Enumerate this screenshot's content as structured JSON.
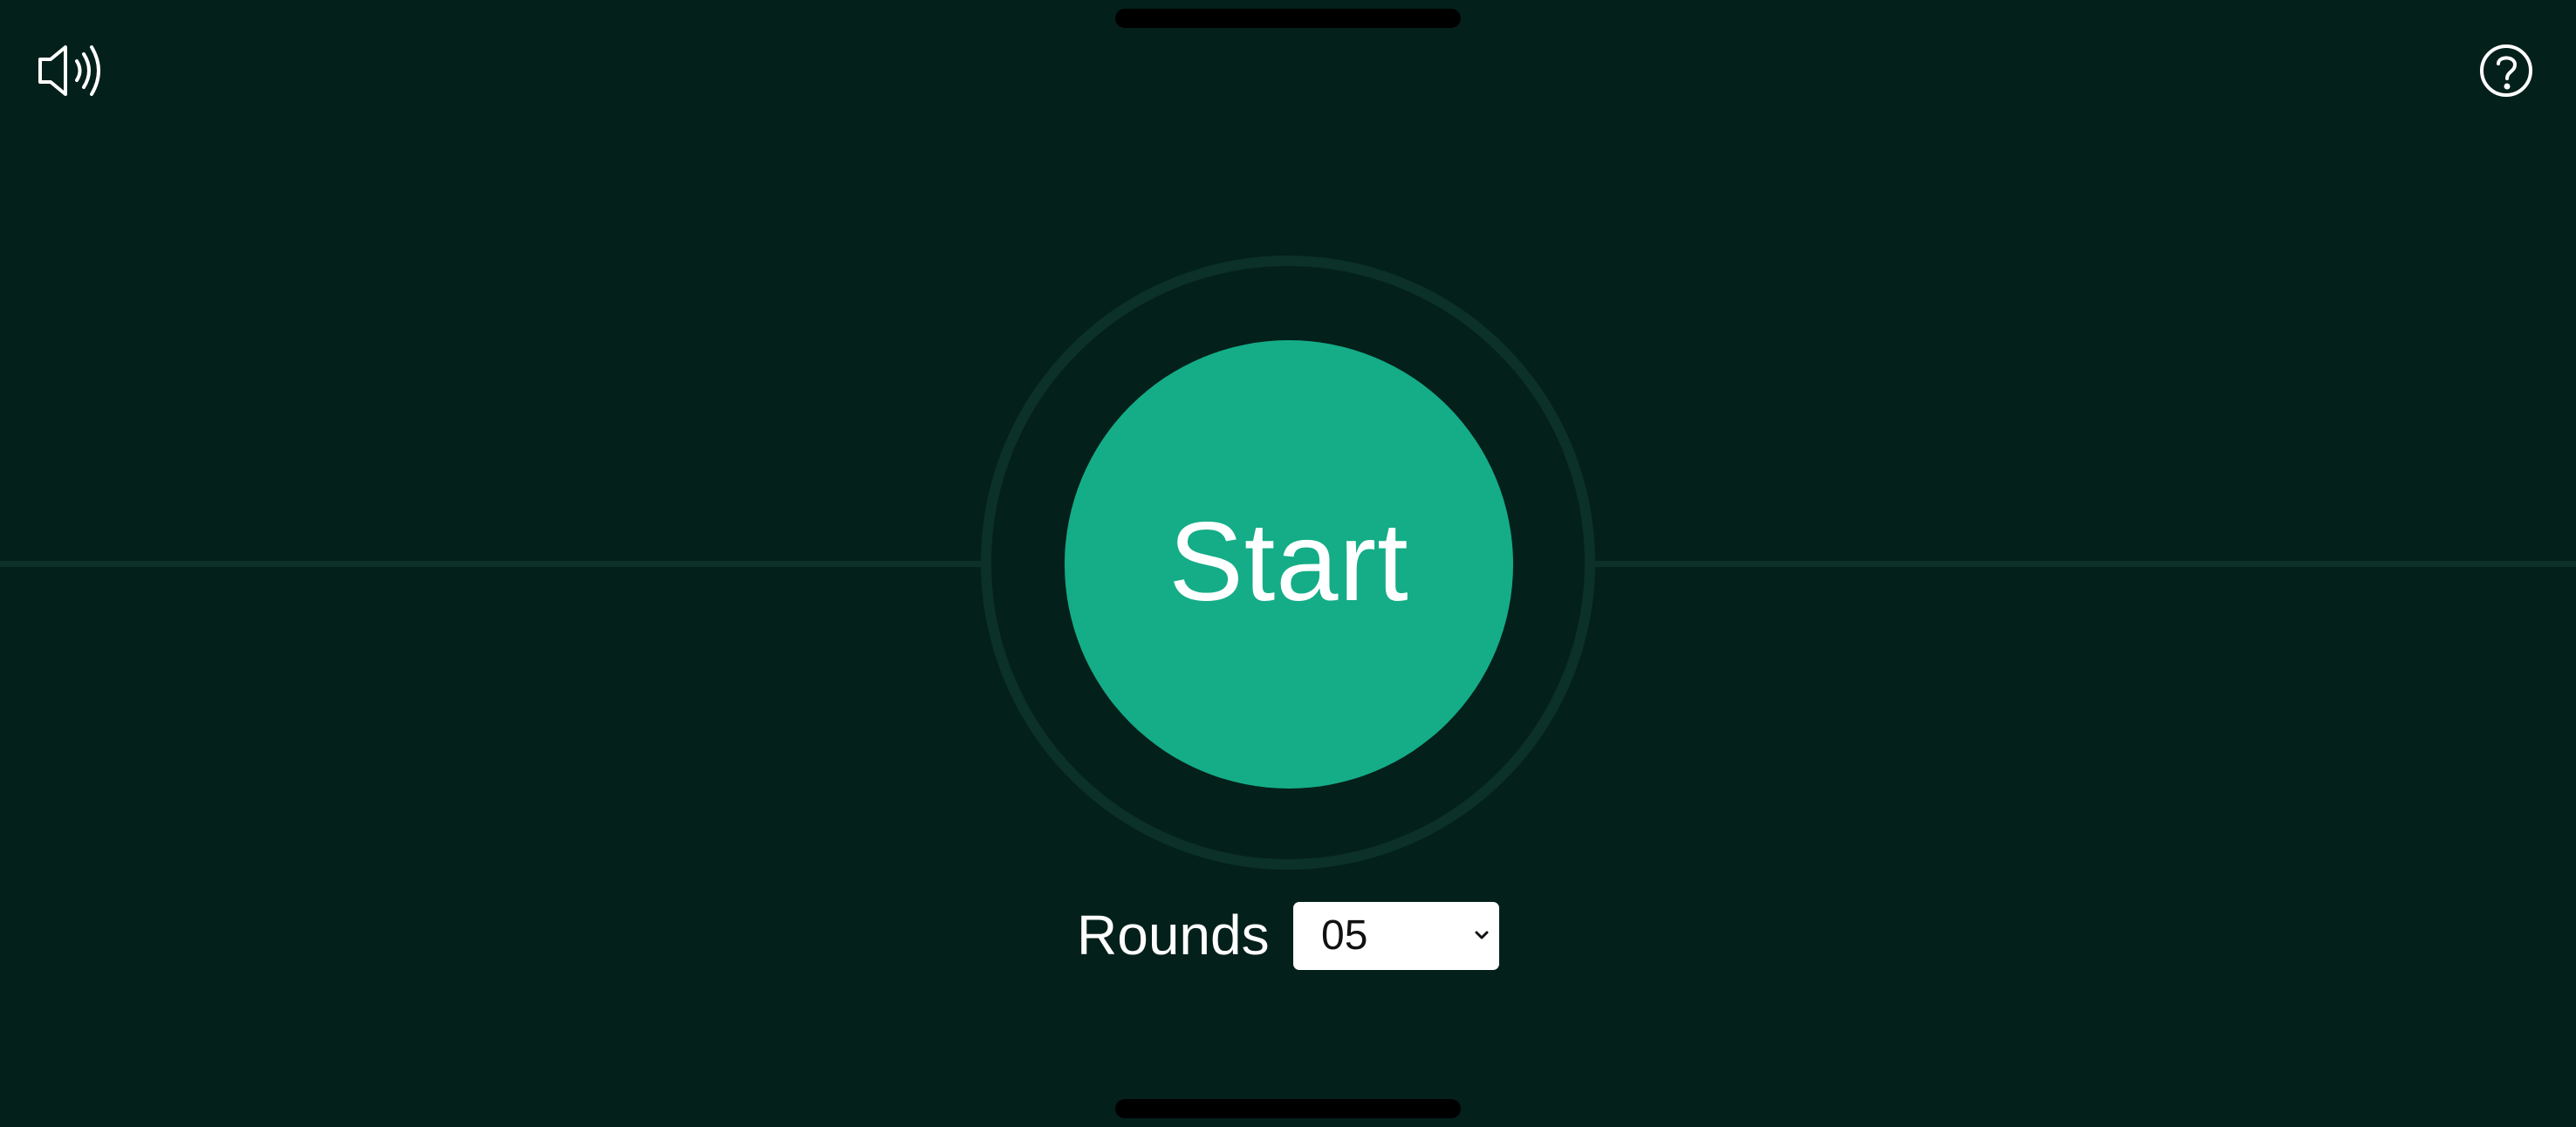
{
  "game": {
    "start_label": "Start",
    "rounds_label": "Rounds",
    "rounds_value": "05"
  },
  "controls": {
    "sound_icon": "speaker-volume-icon",
    "help_icon": "question-mark-icon"
  },
  "colors": {
    "background": "#04201a",
    "button": "#14ad87",
    "ring": "#0b3129",
    "text": "#ffffff",
    "select_background": "#ffffff",
    "select_text": "#111111"
  }
}
